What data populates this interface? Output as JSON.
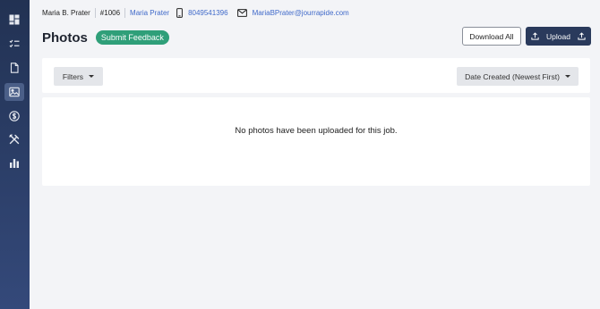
{
  "sidebar": {
    "items": [
      {
        "name": "dashboard-icon",
        "active": false
      },
      {
        "name": "checklist-icon",
        "active": false
      },
      {
        "name": "document-icon",
        "active": false
      },
      {
        "name": "photos-icon",
        "active": true
      },
      {
        "name": "dollar-icon",
        "active": false
      },
      {
        "name": "tools-icon",
        "active": false
      },
      {
        "name": "bar-chart-icon",
        "active": false
      }
    ]
  },
  "header": {
    "customer_name": "Maria B. Prater",
    "job_number": "#1006",
    "contact_name": "Maria Prater",
    "phone": "8049541396",
    "email": "MariaBPrater@jourrapide.com"
  },
  "page": {
    "title": "Photos",
    "feedback_label": "Submit Feedback",
    "download_label": "Download All",
    "upload_label": "Upload"
  },
  "filters": {
    "filters_label": "Filters",
    "sort_selected": "Date Created (Newest First)"
  },
  "content": {
    "empty_message": "No photos have been uploaded for this job."
  },
  "colors": {
    "sidebar": "#2a3a5c",
    "accent_green": "#2f9f79",
    "link_blue": "#3f69c9"
  }
}
